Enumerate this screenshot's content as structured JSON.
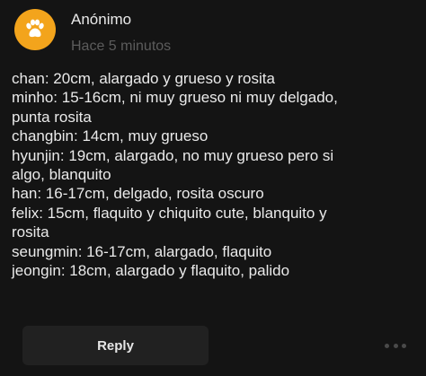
{
  "post": {
    "author": "Anónimo",
    "time": "Hace 5 minutos",
    "avatar_icon": "paw-icon",
    "avatar_color": "#f3a41c",
    "body_lines": [
      "chan: 20cm, alargado y grueso y rosita",
      "minho: 15-16cm, ni muy grueso ni muy delgado,",
      "punta rosita",
      "changbin: 14cm, muy grueso",
      "hyunjin: 19cm, alargado, no muy grueso pero si",
      "algo, blanquito",
      "han: 16-17cm, delgado, rosita oscuro",
      "felix: 15cm, flaquito y chiquito cute, blanquito y",
      "rosita",
      "seungmin: 16-17cm, alargado, flaquito",
      "jeongin: 18cm, alargado y flaquito, palido"
    ]
  },
  "actions": {
    "reply_label": "Reply",
    "more_icon": "more-dots-icon"
  }
}
